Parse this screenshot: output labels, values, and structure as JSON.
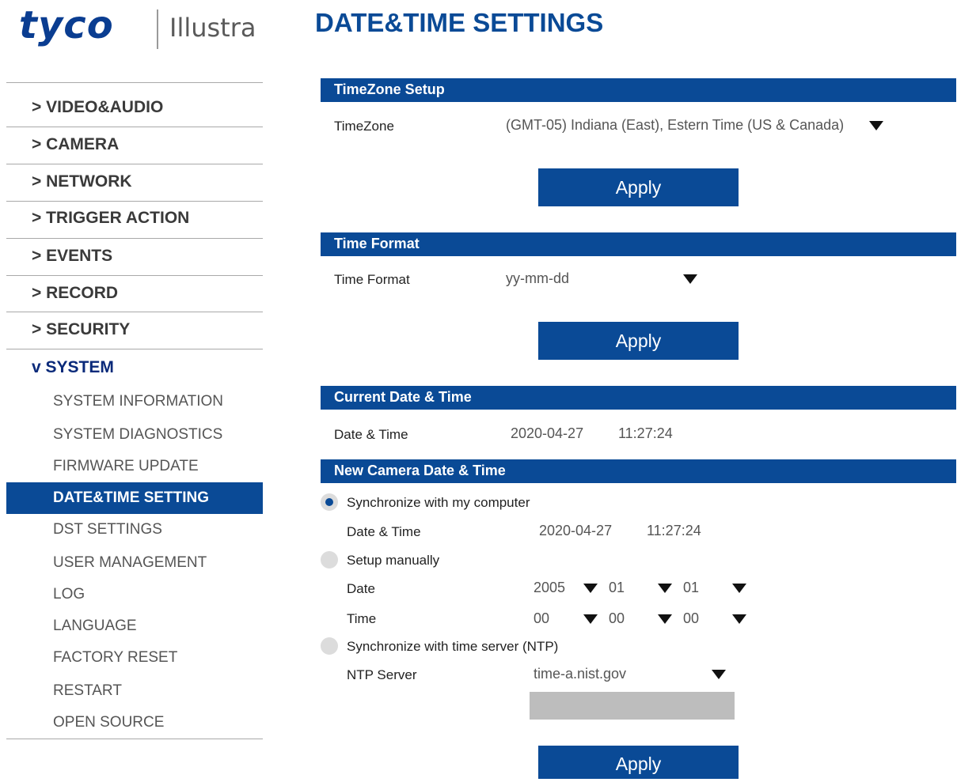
{
  "brand": {
    "name": "tyco",
    "product": "Illustra"
  },
  "page": {
    "title": "DATE&TIME SETTINGS"
  },
  "sidebar": {
    "main_items": [
      {
        "label": "> VIDEO&AUDIO"
      },
      {
        "label": "> CAMERA"
      },
      {
        "label": "> NETWORK"
      },
      {
        "label": "> TRIGGER ACTION"
      },
      {
        "label": "> EVENTS"
      },
      {
        "label": "> RECORD"
      },
      {
        "label": "> SECURITY"
      },
      {
        "label": "v SYSTEM"
      }
    ],
    "sub_items": [
      {
        "label": "SYSTEM INFORMATION"
      },
      {
        "label": "SYSTEM DIAGNOSTICS"
      },
      {
        "label": "FIRMWARE UPDATE"
      },
      {
        "label": "DATE&TIME SETTING",
        "selected": true
      },
      {
        "label": "DST SETTINGS"
      },
      {
        "label": "USER MANAGEMENT"
      },
      {
        "label": "LOG"
      },
      {
        "label": "LANGUAGE"
      },
      {
        "label": "FACTORY RESET"
      },
      {
        "label": "RESTART"
      },
      {
        "label": "OPEN SOURCE"
      }
    ]
  },
  "timezone_setup": {
    "header": "TimeZone Setup",
    "label": "TimeZone",
    "value": "(GMT-05) Indiana (East), Estern Time (US & Canada)",
    "apply": "Apply"
  },
  "time_format": {
    "header": "Time Format",
    "label": "Time Format",
    "value": "yy-mm-dd",
    "apply": "Apply"
  },
  "current_datetime": {
    "header": "Current Date & Time",
    "label": "Date & Time",
    "date": "2020-04-27",
    "time": "11:27:24"
  },
  "new_datetime": {
    "header": "New Camera Date & Time",
    "sync_computer": {
      "label": "Synchronize with my computer",
      "selected": true
    },
    "computer_label": "Date & Time",
    "computer_date": "2020-04-27",
    "computer_time": "11:27:24",
    "manual": {
      "label": "Setup manually",
      "selected": false
    },
    "date_label": "Date",
    "date_year": "2005",
    "date_month": "01",
    "date_day": "01",
    "time_label": "Time",
    "time_hour": "00",
    "time_minute": "00",
    "time_second": "00",
    "ntp": {
      "label": "Synchronize with time server (NTP)",
      "selected": false
    },
    "ntp_server_label": "NTP Server",
    "ntp_server_value": "time-a.nist.gov",
    "ntp_custom_value": "",
    "apply": "Apply"
  },
  "colors": {
    "accent": "#0a4a96",
    "radio_off": "#dcdcdc"
  }
}
